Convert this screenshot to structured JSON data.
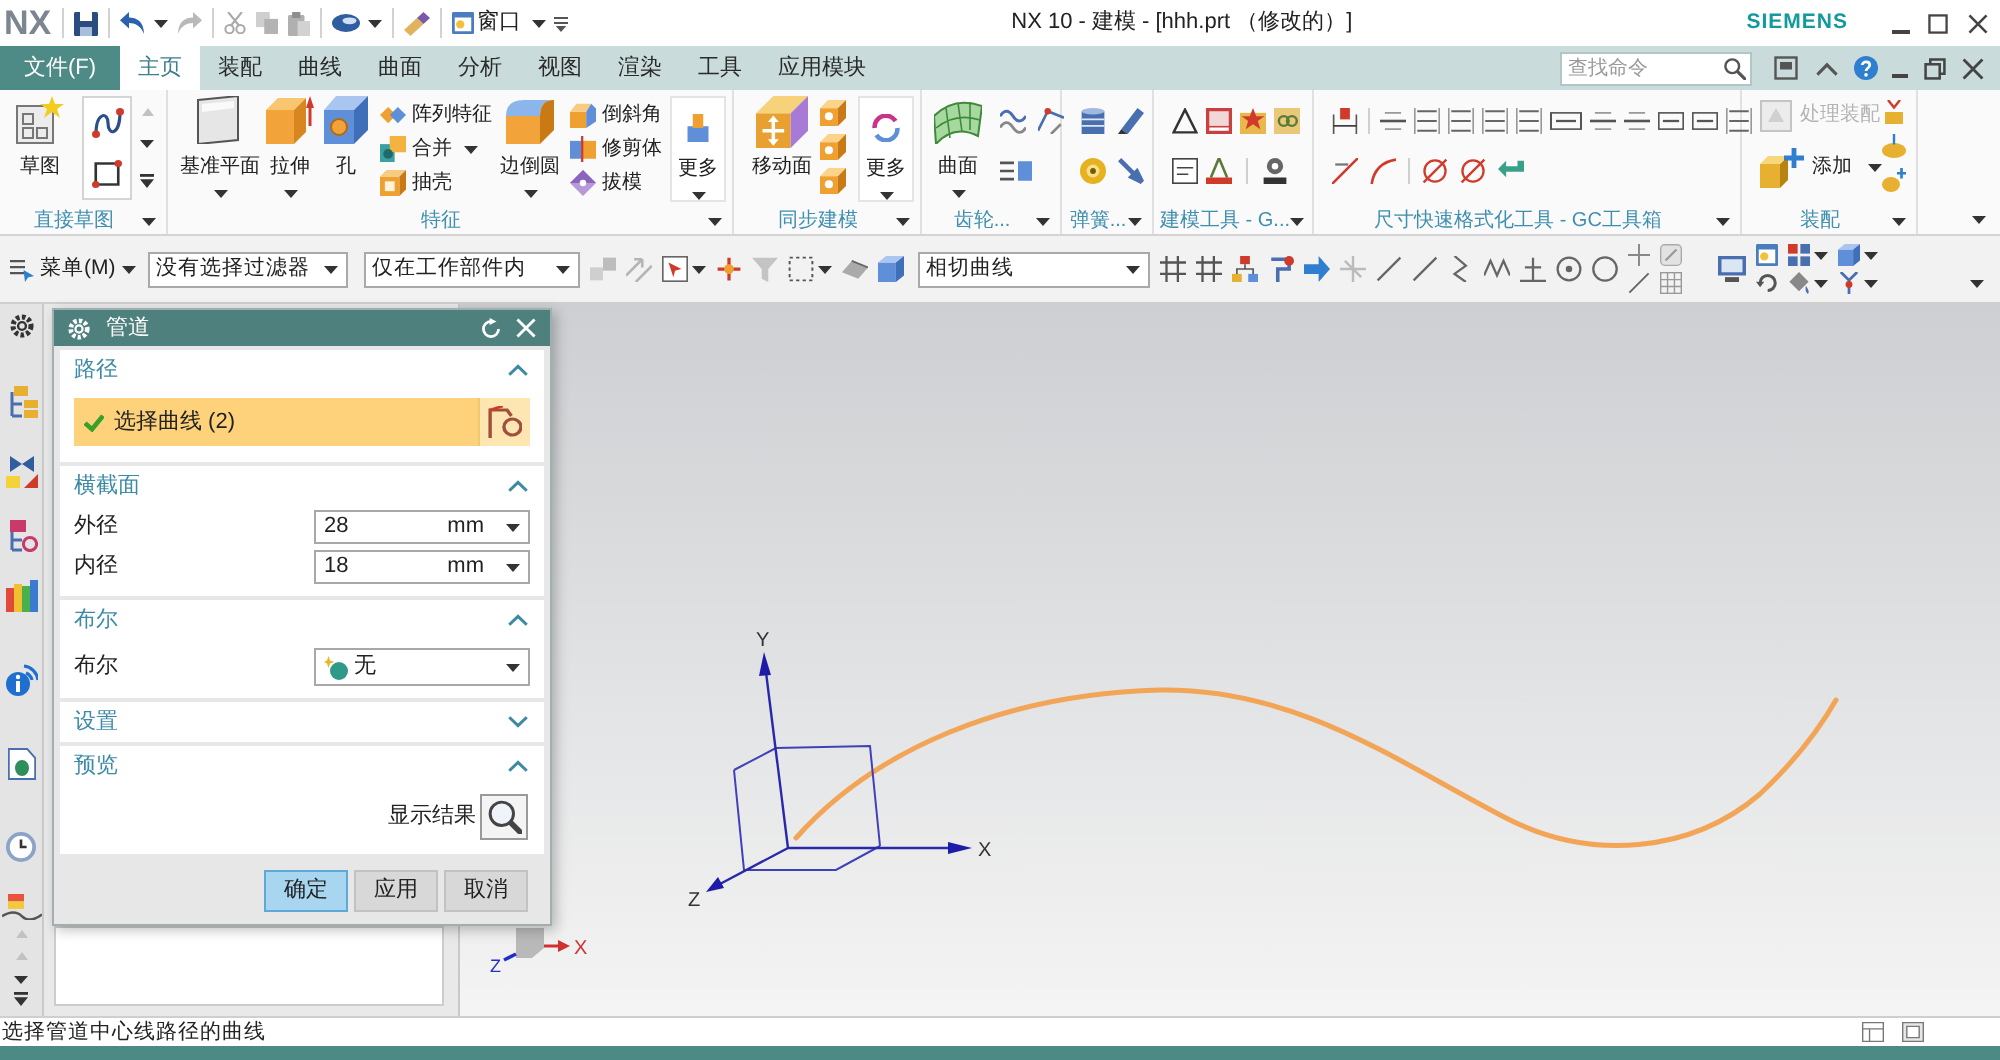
{
  "title_bar": {
    "logo": "NX",
    "window_menu": "窗口",
    "title": "NX 10 - 建模 - [hhh.prt （修改的）]",
    "brand": "SIEMENS"
  },
  "menu_tabs": [
    {
      "label": "文件(F)",
      "kind": "file",
      "selected": false
    },
    {
      "label": "主页",
      "kind": "tab",
      "selected": true
    },
    {
      "label": "装配",
      "kind": "tab",
      "selected": false
    },
    {
      "label": "曲线",
      "kind": "tab",
      "selected": false
    },
    {
      "label": "曲面",
      "kind": "tab",
      "selected": false
    },
    {
      "label": "分析",
      "kind": "tab",
      "selected": false
    },
    {
      "label": "视图",
      "kind": "tab",
      "selected": false
    },
    {
      "label": "渲染",
      "kind": "tab",
      "selected": false
    },
    {
      "label": "工具",
      "kind": "tab",
      "selected": false
    },
    {
      "label": "应用模块",
      "kind": "tab",
      "selected": false
    }
  ],
  "command_search": {
    "placeholder": "查找命令"
  },
  "ribbon_groups": [
    {
      "label": "直接草图",
      "buttons": [
        "草图"
      ]
    },
    {
      "label": "特征",
      "buttons": [
        "基准平面",
        "拉伸",
        "孔",
        "阵列特征",
        "合并",
        "抽壳",
        "边倒圆",
        "倒斜角",
        "修剪体",
        "拔模",
        "更多"
      ]
    },
    {
      "label": "同步建模",
      "buttons": [
        "移动面",
        "更多"
      ]
    },
    {
      "label": "齿轮...",
      "buttons": [
        "曲面"
      ]
    },
    {
      "label": "弹簧..."
    },
    {
      "label": "建模工具 - G..."
    },
    {
      "label": "尺寸快速格式化工具 - GC工具箱"
    },
    {
      "label": "装配",
      "buttons": [
        {
          "label": "处理装配",
          "disabled": true
        },
        {
          "label": "添加",
          "disabled": false
        }
      ]
    }
  ],
  "toolbar": {
    "menu": "菜单(M)",
    "selection_filter": "没有选择过滤器",
    "scope_filter": "仅在工作部件内",
    "curve_rule": "相切曲线"
  },
  "dialog": {
    "title": "管道",
    "sections": [
      {
        "title": "路径",
        "kind": "selection",
        "expanded": true,
        "selection": {
          "label": "选择曲线 (2)",
          "active": true,
          "done": true
        }
      },
      {
        "title": "横截面",
        "kind": "fields",
        "expanded": true,
        "fields": [
          {
            "label": "外径",
            "value": "28",
            "unit": "mm"
          },
          {
            "label": "内径",
            "value": "18",
            "unit": "mm"
          }
        ]
      },
      {
        "title": "布尔",
        "kind": "dropdown",
        "expanded": true,
        "label": "布尔",
        "value": "无"
      },
      {
        "title": "设置",
        "expanded": false
      },
      {
        "title": "预览",
        "kind": "preview",
        "expanded": true,
        "label": "显示结果"
      }
    ],
    "buttons": [
      {
        "label": "确定",
        "default": true
      },
      {
        "label": "应用",
        "default": false
      },
      {
        "label": "取消",
        "default": false
      }
    ]
  },
  "viewport": {
    "wcs_axes": {
      "x": "X",
      "y": "Y",
      "z": "Z"
    },
    "view_triad": {
      "x": "X",
      "z": "Z"
    }
  },
  "status_bar": {
    "message": "选择管道中心线路径的曲线"
  }
}
